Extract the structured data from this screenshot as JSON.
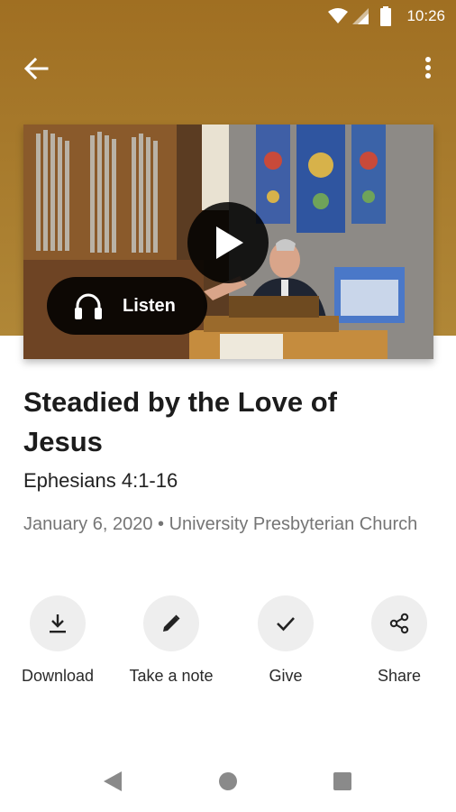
{
  "status_bar": {
    "time": "10:26",
    "icons": [
      "wifi-icon",
      "signal-icon",
      "battery-icon"
    ]
  },
  "toolbar": {
    "back_icon": "arrow-back-icon",
    "more_icon": "more-vert-icon"
  },
  "media": {
    "play_icon": "play-icon",
    "listen_label": "Listen",
    "listen_icon": "headphones-icon"
  },
  "sermon": {
    "title": "Steadied by the Love of Jesus",
    "passage": "Ephesians 4:1-16",
    "date": "January 6, 2020",
    "separator": "•",
    "church": "University Presbyterian Church"
  },
  "actions": [
    {
      "label": "Download",
      "icon": "download-icon"
    },
    {
      "label": "Take a note",
      "icon": "pencil-icon"
    },
    {
      "label": "Give",
      "icon": "check-icon"
    },
    {
      "label": "Share",
      "icon": "share-icon"
    }
  ],
  "nav_bar": {
    "icons": [
      "nav-back-icon",
      "nav-home-icon",
      "nav-recents-icon"
    ]
  },
  "colors": {
    "header": "#a77a2c",
    "action_circle": "#eeeeee",
    "meta_text": "#757575"
  }
}
